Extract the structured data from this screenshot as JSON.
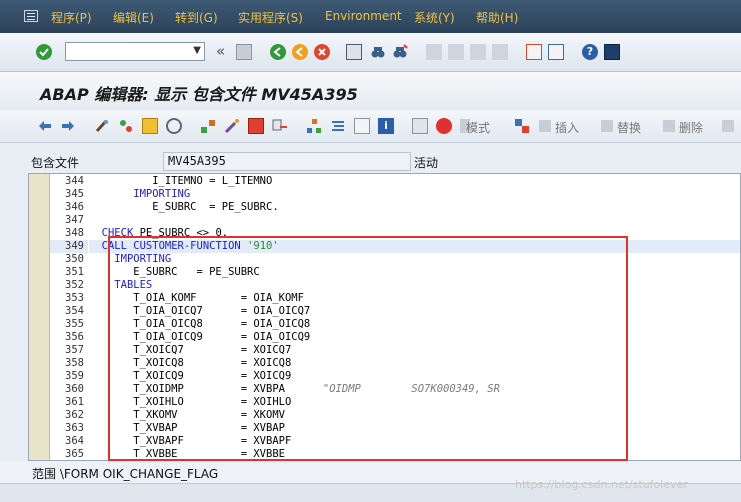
{
  "menubar": {
    "items": [
      "程序(P)",
      "编辑(E)",
      "转到(G)",
      "实用程序(S)",
      "Environment",
      "系统(Y)",
      "帮助(H)"
    ]
  },
  "toolbar1": {
    "back_symbol": "«"
  },
  "title": "ABAP 编辑器: 显示 包含文件 MV45A395",
  "toolbar2": {
    "pattern_label": "模式",
    "insert_label": "插入",
    "replace_label": "替换",
    "delete_label": "删除",
    "extra_label": "取"
  },
  "include": {
    "label": "包含文件",
    "value": "MV45A395",
    "status": "活动"
  },
  "code": {
    "highlighted_line": 349,
    "lines": [
      {
        "no": "344",
        "text": "          I_ITEMNO = L_ITEMNO"
      },
      {
        "no": "345",
        "text": "       IMPORTING"
      },
      {
        "no": "346",
        "text": "          E_SUBRC  = PE_SUBRC."
      },
      {
        "no": "347",
        "text": ""
      },
      {
        "no": "348",
        "text": "  CHECK PE_SUBRC <> 0."
      },
      {
        "no": "349",
        "text": "  CALL CUSTOMER-FUNCTION '910'"
      },
      {
        "no": "350",
        "text": "    IMPORTING"
      },
      {
        "no": "351",
        "text": "       E_SUBRC   = PE_SUBRC"
      },
      {
        "no": "352",
        "text": "    TABLES"
      },
      {
        "no": "353",
        "text": "       T_OIA_KOMF       = OIA_KOMF"
      },
      {
        "no": "354",
        "text": "       T_OIA_OICQ7      = OIA_OICQ7"
      },
      {
        "no": "355",
        "text": "       T_OIA_OICQ8      = OIA_OICQ8"
      },
      {
        "no": "356",
        "text": "       T_OIA_OICQ9      = OIA_OICQ9"
      },
      {
        "no": "357",
        "text": "       T_XOICQ7         = XOICQ7"
      },
      {
        "no": "358",
        "text": "       T_XOICQ8         = XOICQ8"
      },
      {
        "no": "359",
        "text": "       T_XOICQ9         = XOICQ9"
      },
      {
        "no": "360",
        "text": "       T_XOIDMP         = XVBPA      \"OIDMP        SO7K000349, SR"
      },
      {
        "no": "361",
        "text": "       T_XOIHLO         = XOIHLO"
      },
      {
        "no": "362",
        "text": "       T_XKOMV          = XKOMV"
      },
      {
        "no": "363",
        "text": "       T_XVBAP          = XVBAP"
      },
      {
        "no": "364",
        "text": "       T_XVBAPF         = XVBAPF"
      },
      {
        "no": "365",
        "text": "       T_XVBBE          = XVBBE"
      }
    ]
  },
  "status": {
    "scope": "范围 \\FORM OIK_CHANGE_FLAG"
  },
  "watermark": "https://blog.csdn.net/stufolever"
}
